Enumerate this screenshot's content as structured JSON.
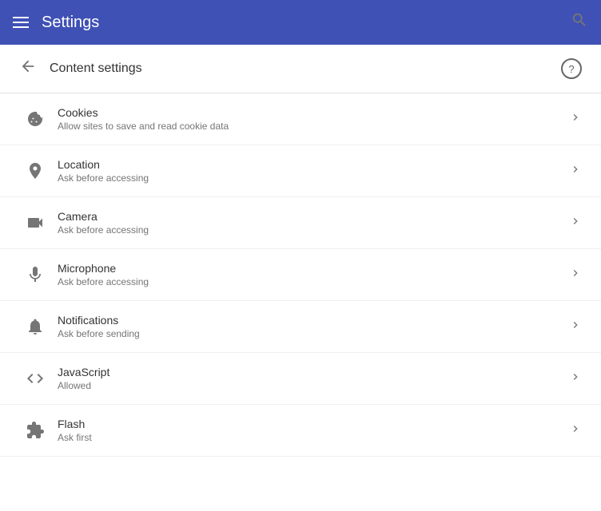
{
  "appBar": {
    "title": "Settings",
    "hamburgerLabel": "menu",
    "searchLabel": "search"
  },
  "pageHeader": {
    "backLabel": "back",
    "title": "Content settings",
    "helpLabel": "help"
  },
  "settingsItems": [
    {
      "id": "cookies",
      "title": "Cookies",
      "subtitle": "Allow sites to save and read cookie data",
      "iconType": "cookies"
    },
    {
      "id": "location",
      "title": "Location",
      "subtitle": "Ask before accessing",
      "iconType": "location"
    },
    {
      "id": "camera",
      "title": "Camera",
      "subtitle": "Ask before accessing",
      "iconType": "camera"
    },
    {
      "id": "microphone",
      "title": "Microphone",
      "subtitle": "Ask before accessing",
      "iconType": "microphone"
    },
    {
      "id": "notifications",
      "title": "Notifications",
      "subtitle": "Ask before sending",
      "iconType": "notifications"
    },
    {
      "id": "javascript",
      "title": "JavaScript",
      "subtitle": "Allowed",
      "iconType": "javascript"
    },
    {
      "id": "flash",
      "title": "Flash",
      "subtitle": "Ask first",
      "iconType": "flash"
    }
  ]
}
